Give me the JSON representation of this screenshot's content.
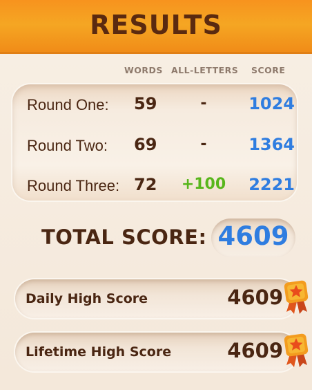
{
  "header": {
    "title": "RESULTS"
  },
  "columns": {
    "words": "WORDS",
    "all_letters": "ALL-LETTERS",
    "score": "SCORE"
  },
  "rounds": [
    {
      "label": "Round One:",
      "words": "59",
      "all_letters": "-",
      "score": "1024"
    },
    {
      "label": "Round Two:",
      "words": "69",
      "all_letters": "-",
      "score": "1364"
    },
    {
      "label": "Round Three:",
      "words": "72",
      "all_letters": "+100",
      "score": "2221"
    }
  ],
  "total": {
    "label": "TOTAL SCORE:",
    "value": "4609"
  },
  "high_scores": [
    {
      "label": "Daily High Score",
      "value": "4609",
      "icon": "star-medal-icon"
    },
    {
      "label": "Lifetime High Score",
      "value": "4609",
      "icon": "star-medal-icon"
    }
  ],
  "colors": {
    "header_orange": "#f5a623",
    "title_brown": "#5a2a10",
    "text_brown": "#4a2612",
    "score_blue": "#2f7de0",
    "bonus_green": "#58b61c",
    "medal_orange": "#f39c1f",
    "medal_star": "#e94c1c"
  }
}
